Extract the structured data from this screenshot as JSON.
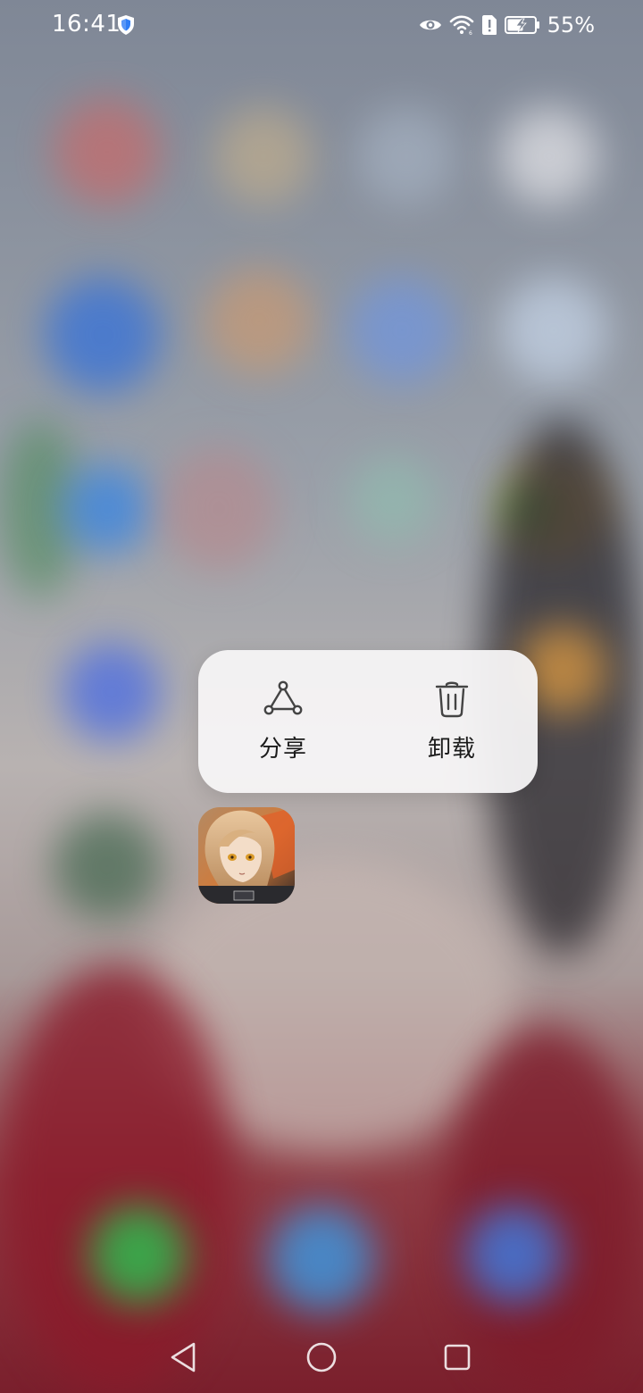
{
  "status_bar": {
    "time": "16:41",
    "battery_percent": "55%",
    "icons": [
      "shield-icon",
      "eye-icon",
      "wifi-icon",
      "sim-alert-icon",
      "battery-charging-icon"
    ]
  },
  "popup_menu": {
    "share_label": "分享",
    "share_icon": "share-nodes-icon",
    "uninstall_label": "卸载",
    "uninstall_icon": "trash-icon"
  },
  "navigation": {
    "back_icon": "back-triangle-icon",
    "home_icon": "home-circle-icon",
    "recents_icon": "recents-square-icon"
  },
  "colors": {
    "popup_background": "#f6f5f7",
    "text": "#1b1b1b",
    "icon_stroke": "#444444"
  }
}
